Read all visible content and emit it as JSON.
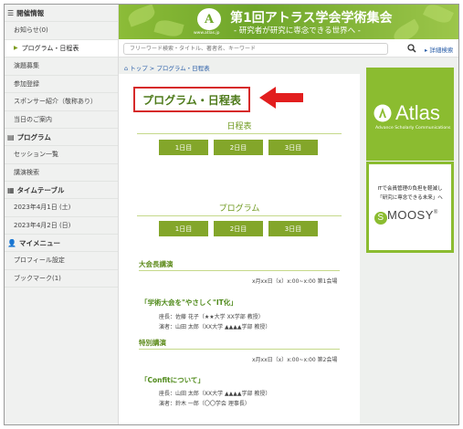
{
  "sidebar": {
    "sections": [
      {
        "icon": "list-icon",
        "title": "開催情報",
        "items": [
          "お知らせ(0)",
          "プログラム・日程表",
          "演題募集",
          "参加登録",
          "スポンサー紹介（敬称あり）",
          "当日のご案内"
        ]
      },
      {
        "icon": "book-icon",
        "title": "プログラム",
        "items": [
          "セッション一覧",
          "講演検索"
        ]
      },
      {
        "icon": "calendar-icon",
        "title": "タイムテーブル",
        "items": [
          "2023年4月1日 (土)",
          "2023年4月2日 (日)"
        ]
      },
      {
        "icon": "user-icon",
        "title": "マイメニュー",
        "items": [
          "プロフィール設定",
          "ブックマーク(1)"
        ]
      }
    ],
    "active_item": "プログラム・日程表"
  },
  "banner": {
    "title": "第1回アトラス学会学術集会",
    "subtitle": "- 研究者が研究に専念できる世界へ -",
    "logo_url": "www.atlas.jp"
  },
  "search": {
    "placeholder": "フリーワード検索・タイトル、著者名、キーワード",
    "advanced_label": "詳細検索"
  },
  "breadcrumb": {
    "home": "トップ",
    "sep": ">",
    "current": "プログラム・日程表"
  },
  "main": {
    "page_title": "プログラム・日程表",
    "schedule": {
      "heading": "日程表",
      "buttons": [
        "1日目",
        "2日目",
        "3日目"
      ]
    },
    "program": {
      "heading": "プログラム",
      "buttons": [
        "1日目",
        "2日目",
        "3日目"
      ]
    },
    "blocks": [
      {
        "heading": "大会長講演",
        "time": "x月xx日（x）x:00~x:00 第1会場",
        "session": "「学術大会を\"やさしく\"IT化」",
        "people": [
          "座長：佐藤 花子（★★大学 XX学部 教授）",
          "演者：山田 太郎（XX大学 ▲▲▲▲学部 教授）"
        ]
      },
      {
        "heading": "特別講演",
        "time": "x月xx日（x）x:00~x:00 第2会場",
        "session": "「Confitについて」",
        "people": [
          "座長：山田 太郎（XX大学 ▲▲▲▲学部 教授）",
          "演者：鈴木 一郎（〇〇学会 理事長）"
        ]
      }
    ]
  },
  "ads": {
    "atlas": {
      "brand": "Atlas",
      "tagline": "Advance Scholarly Communications"
    },
    "moosy": {
      "line1": "ITで会員管理の負担を軽減し",
      "line2": "「研究に専念できる未来」へ",
      "brand": "MOOSY",
      "mark": "®"
    }
  },
  "colors": {
    "accent": "#83a62a",
    "highlight": "#d62a2a",
    "link": "#2a5ea8"
  }
}
